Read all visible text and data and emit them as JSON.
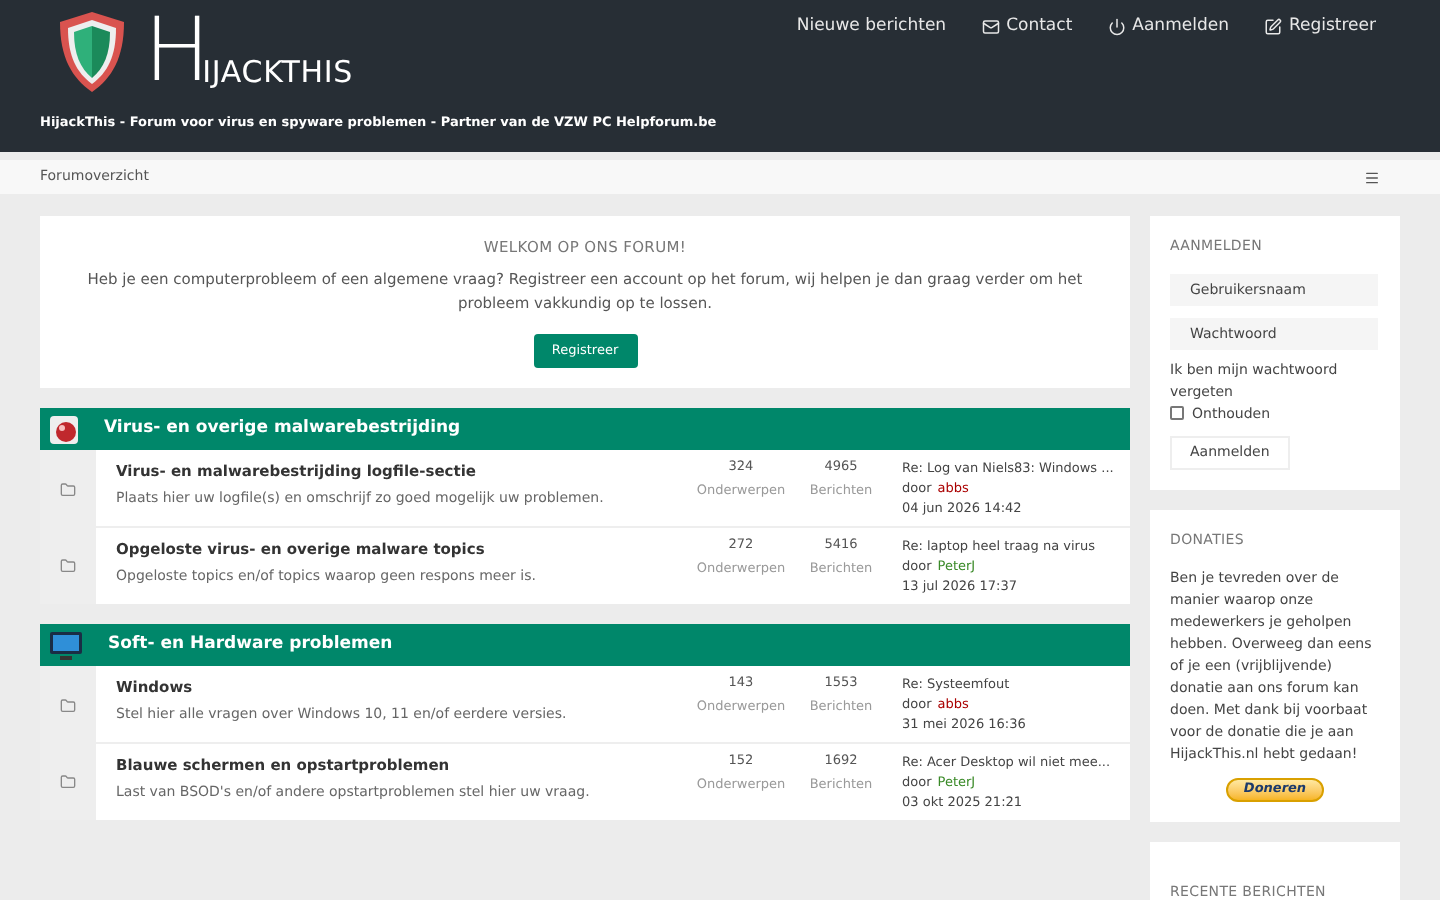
{
  "header": {
    "logo": "HIJACKTHIS",
    "tagline": "HijackThis - Forum voor virus en spyware problemen - Partner van de VZW PC Helpforum.be",
    "nav": [
      {
        "label": "Nieuwe berichten",
        "kind": "plain"
      },
      {
        "label": "Contact",
        "kind": "mail"
      },
      {
        "label": "Aanmelden",
        "kind": "power"
      },
      {
        "label": "Registreer",
        "kind": "edit"
      }
    ]
  },
  "breadcrumb": "Forumoverzicht",
  "welcome": {
    "title": "WELKOM OP ONS FORUM!",
    "text": "Heb je een computerprobleem of een algemene vraag? Registreer een account op het forum, wij helpen je dan graag verder om het probleem vakkundig op te lossen.",
    "button": "Registreer"
  },
  "categories": [
    {
      "title": "Virus- en overige malwarebestrijding",
      "kind": "virus",
      "forums": [
        {
          "title": "Virus- en malwarebestrijding logfile-sectie",
          "description": "Plaats hier uw logfile(s) en omschrijf zo goed mogelijk uw problemen.",
          "topics": "324",
          "topics_label": "Onderwerpen",
          "posts": "4965",
          "posts_label": "Berichten",
          "last_post": {
            "title": "Re: Log van Niels83: Windows ...",
            "by": "door",
            "author": "abbs",
            "color": "#aa0000",
            "date": "04 jun 2026 14:42"
          }
        },
        {
          "title": "Opgeloste virus- en overige malware topics",
          "description": "Opgeloste topics en/of topics waarop geen respons meer is.",
          "topics": "272",
          "topics_label": "Onderwerpen",
          "posts": "5416",
          "posts_label": "Berichten",
          "last_post": {
            "title": "Re: laptop heel traag na virus",
            "by": "door",
            "author": "PeterJ",
            "color": "#3a8a28",
            "date": "13 jul 2026 17:37"
          }
        }
      ]
    },
    {
      "title": "Soft- en Hardware problemen",
      "kind": "monitor",
      "forums": [
        {
          "title": "Windows",
          "description": "Stel hier alle vragen over Windows 10, 11 en/of eerdere versies.",
          "topics": "143",
          "topics_label": "Onderwerpen",
          "posts": "1553",
          "posts_label": "Berichten",
          "last_post": {
            "title": "Re: Systeemfout",
            "by": "door",
            "author": "abbs",
            "color": "#aa0000",
            "date": "31 mei 2026 16:36"
          }
        },
        {
          "title": "Blauwe schermen en opstartproblemen",
          "description": "Last van BSOD's en/of andere opstartproblemen stel hier uw vraag.",
          "topics": "152",
          "topics_label": "Onderwerpen",
          "posts": "1692",
          "posts_label": "Berichten",
          "last_post": {
            "title": "Re: Acer Desktop wil niet mee...",
            "by": "door",
            "author": "PeterJ",
            "color": "#3a8a28",
            "date": "03 okt 2025 21:21"
          }
        }
      ]
    }
  ],
  "login": {
    "title": "AANMELDEN",
    "username_placeholder": "Gebruikersnaam",
    "password_placeholder": "Wachtwoord",
    "forgot": "Ik ben mijn wachtwoord vergeten",
    "remember": {
      "label": "Onthouden",
      "checked": false
    },
    "button": "Aanmelden"
  },
  "donations": {
    "title": "DONATIES",
    "text": "Ben je tevreden over de manier waarop onze medewerkers je geholpen hebben. Overweeg dan eens of je een (vrijblijvende) donatie aan ons forum kan doen. Met dank bij voorbaat voor de donatie die je aan HijackThis.nl hebt gedaan!",
    "button": "Doneren"
  },
  "recent": {
    "title": "RECENTE BERICHTEN"
  }
}
